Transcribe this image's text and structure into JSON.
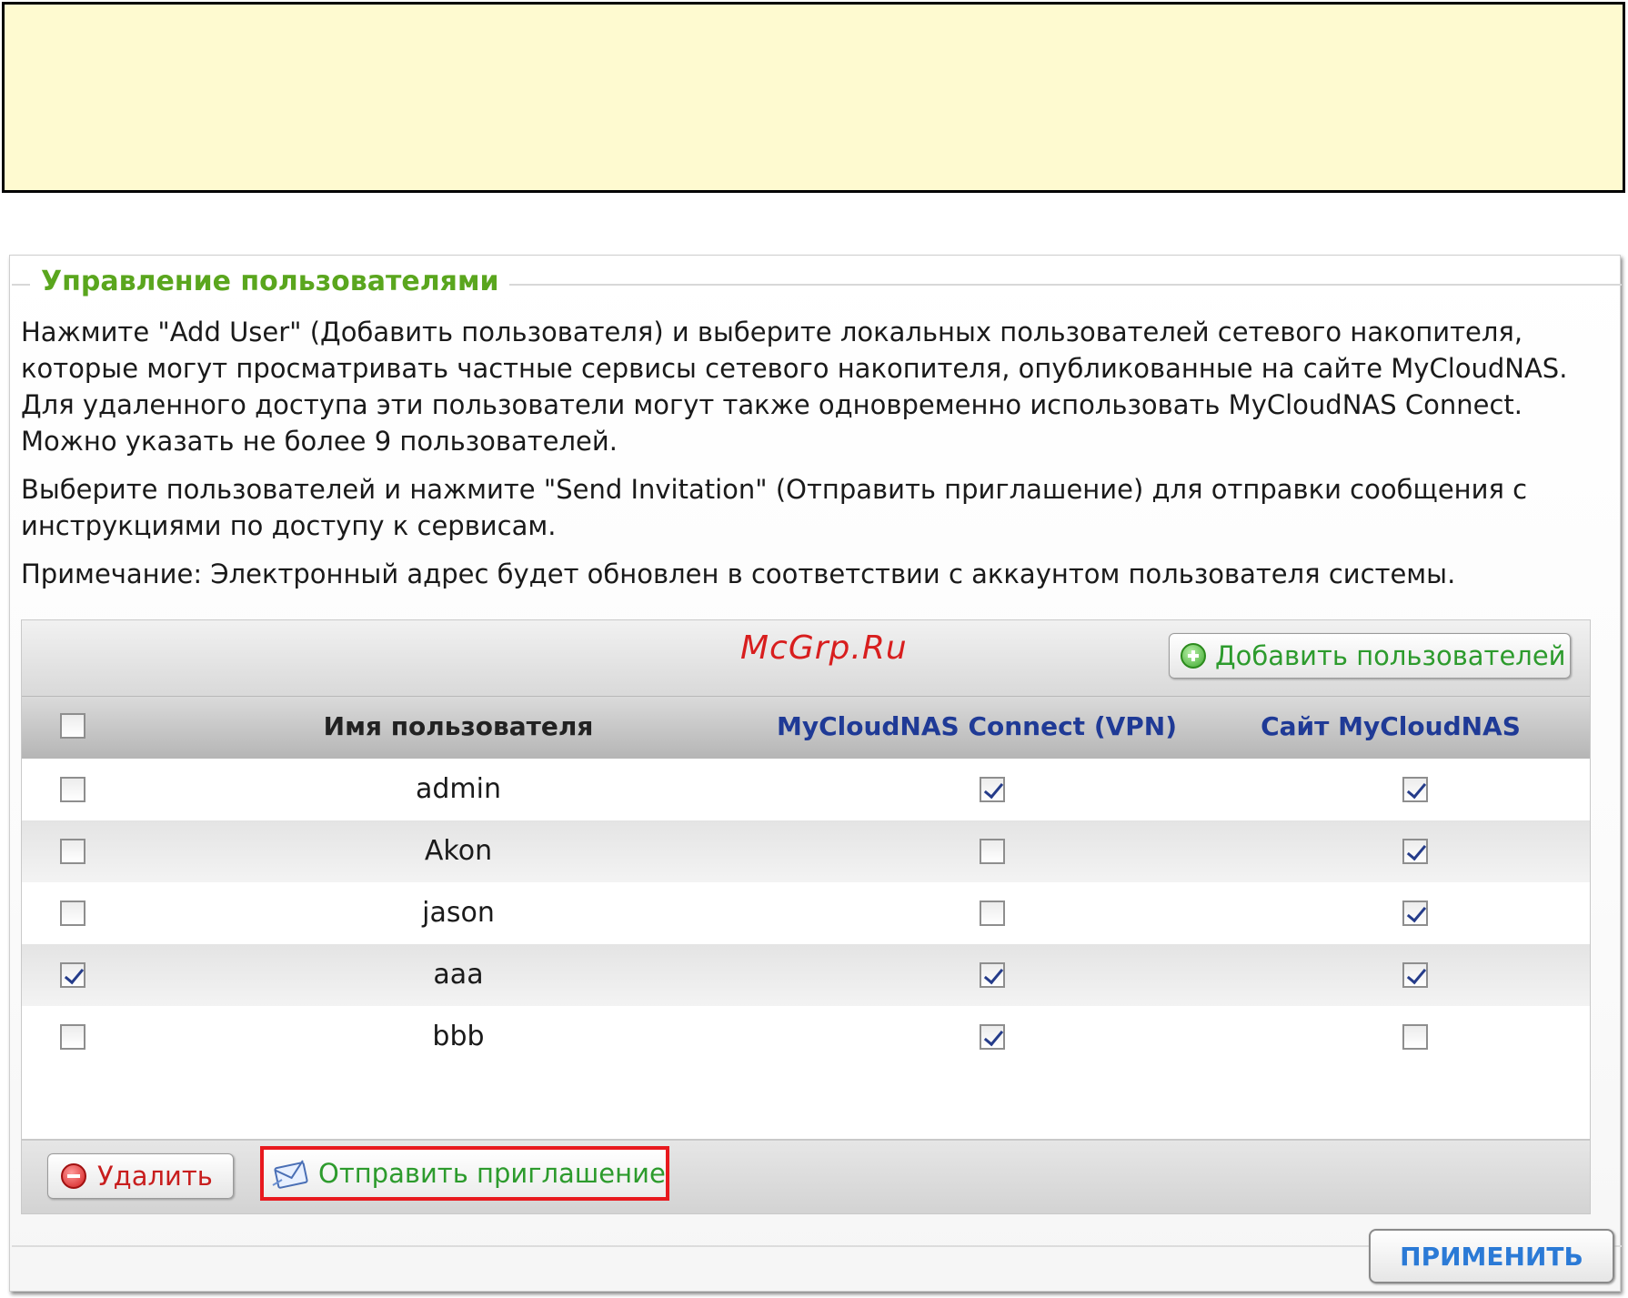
{
  "panel": {
    "title": "Управление пользователями",
    "description_1": "Нажмите \"Add User\" (Добавить пользователя) и выберите локальных пользователей сетевого накопителя, которые могут просматривать частные сервисы сетевого накопителя, опубликованные на сайте MyCloudNAS. Для удаленного доступа эти пользователи могут также одновременно использовать MyCloudNAS Connect. Можно указать не более 9 пользователей.",
    "description_2": "Выберите пользователей и нажмите \"Send Invitation\" (Отправить приглашение) для отправки сообщения с инструкциями по доступу к сервисам.",
    "note": "Примечание: Электронный адрес будет обновлен в соответствии с аккаунтом пользователя системы."
  },
  "watermark": "McGrp.Ru",
  "toolbar": {
    "add_label": "Добавить пользователей"
  },
  "table": {
    "headers": {
      "select_all_checked": false,
      "username": "Имя пользователя",
      "vpn": "MyCloudNAS Connect (VPN)",
      "site": "Сайт MyCloudNAS"
    },
    "rows": [
      {
        "selected": false,
        "name": "admin",
        "vpn": true,
        "site": true
      },
      {
        "selected": false,
        "name": "Akon",
        "vpn": false,
        "site": true
      },
      {
        "selected": false,
        "name": "jason",
        "vpn": false,
        "site": true
      },
      {
        "selected": true,
        "name": "aaa",
        "vpn": true,
        "site": true
      },
      {
        "selected": false,
        "name": "bbb",
        "vpn": true,
        "site": false
      }
    ]
  },
  "footer": {
    "delete_label": "Удалить",
    "invite_label": "Отправить приглашение"
  },
  "apply_label": "ПРИМЕНИТЬ",
  "colors": {
    "title_green": "#5aa61e",
    "header_blue": "#1f3a96",
    "highlight_red": "#e8191e",
    "note_box_bg": "#fefad0"
  }
}
